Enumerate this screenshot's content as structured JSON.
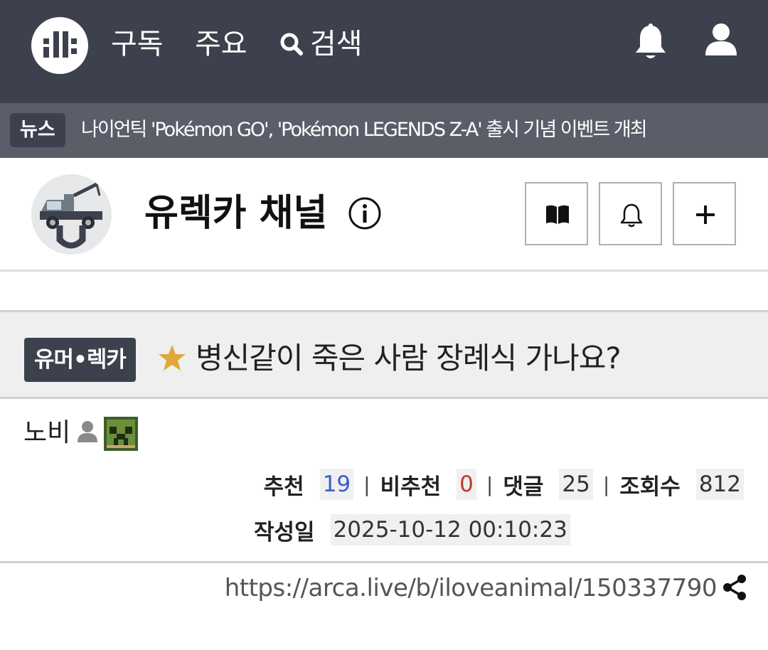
{
  "nav": {
    "logo_icon": "site-logo-icon",
    "subscribe": "구독",
    "main": "주요",
    "search": "검색",
    "notification_icon": "bell-icon",
    "profile_icon": "user-icon"
  },
  "news": {
    "badge": "뉴스",
    "headline": "나이언틱 'Pokémon GO', 'Pokémon LEGENDS Z-A' 출시 기념 이벤트 개최"
  },
  "channel": {
    "name": "유렉카 채널",
    "info_icon": "info-icon",
    "buttons": [
      "book-icon",
      "bell-icon",
      "plus-icon"
    ]
  },
  "post": {
    "category": "유머•렉카",
    "star_color": "#e0a83a",
    "title": "병신같이 죽은 사람 장례식 가나요?",
    "author": "노비",
    "stats": {
      "recommend_label": "추천",
      "recommend": "19",
      "unrecommend_label": "비추천",
      "unrecommend": "0",
      "comments_label": "댓글",
      "comments": "25",
      "views_label": "조회수",
      "views": "812",
      "date_label": "작성일",
      "date": "2025-10-12 00:10:23",
      "separator": "|"
    },
    "url": "https://arca.live/b/iloveanimal/150337790"
  },
  "colors": {
    "nav_bg": "#3d414d",
    "news_bg": "#5a5e69",
    "recommend": "#3b5fc8",
    "unrecommend": "#c0392b"
  }
}
